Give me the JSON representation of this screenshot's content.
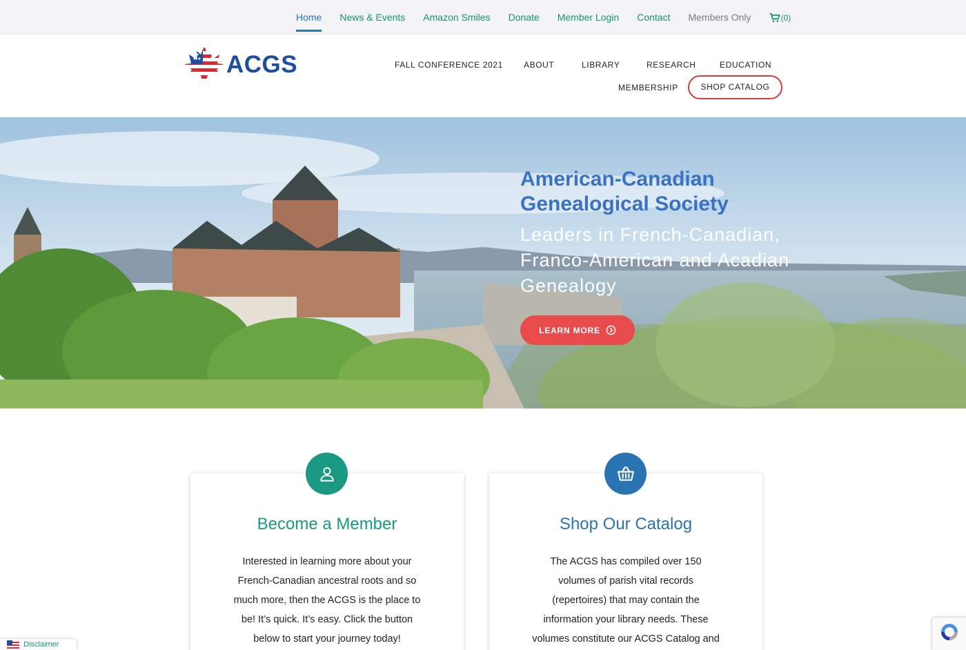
{
  "topnav": {
    "items": [
      {
        "label": "Home"
      },
      {
        "label": "News & Events"
      },
      {
        "label": "Amazon Smiles"
      },
      {
        "label": "Donate"
      },
      {
        "label": "Member Login"
      },
      {
        "label": "Contact"
      },
      {
        "label": "Members Only"
      }
    ],
    "cart_count": "(0)"
  },
  "logo": {
    "text": "ACGS"
  },
  "mainnav": {
    "items": [
      {
        "label": "FALL CONFERENCE 2021"
      },
      {
        "label": "ABOUT"
      },
      {
        "label": "LIBRARY"
      },
      {
        "label": "RESEARCH"
      },
      {
        "label": "EDUCATION"
      },
      {
        "label": "MEMBERSHIP"
      }
    ],
    "shop_label": "SHOP CATALOG"
  },
  "hero": {
    "title": "American-Canadian Genealogical Society",
    "subtitle": "Leaders in French-Canadian, Franco-American and Acadian Genealogy",
    "button": "LEARN MORE"
  },
  "cards": [
    {
      "title": "Become a Member",
      "text": "Interested in learning more about your French-Canadian ancestral roots and so much more, then the ACGS is the place to be! It’s quick. It’s easy. Click the button below to start your journey today!",
      "icon": "user-icon",
      "color": "#1a9a83"
    },
    {
      "title": "Shop Our Catalog",
      "text": "The ACGS has compiled over 150 volumes of parish vital records (repertoires) that may contain the information your library needs.  These volumes constitute our ACGS Catalog and are available for purchase.",
      "icon": "basket-icon",
      "color": "#2a74b3"
    }
  ],
  "footer": {
    "disclaimer": "Disclaimer"
  },
  "colors": {
    "accent_green": "#17917a",
    "accent_blue": "#2a74b3",
    "accent_red": "#e84b4b",
    "brand_navy": "#1f4e9c"
  }
}
